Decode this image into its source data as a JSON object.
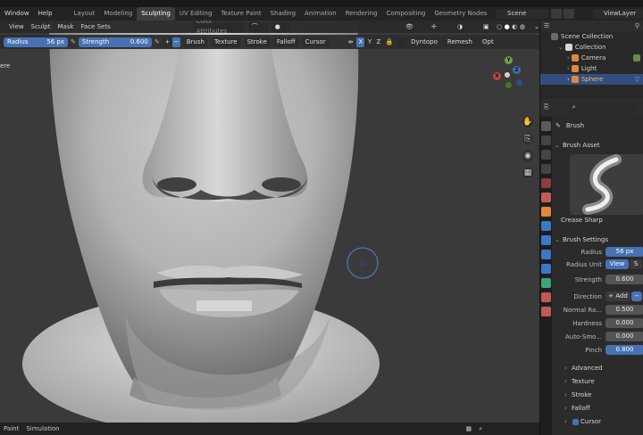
{
  "topbar": {
    "menus": [
      "Window",
      "Help"
    ],
    "workspace_tabs": [
      "Layout",
      "Modeling",
      "Sculpting",
      "UV Editing",
      "Texture Paint",
      "Shading",
      "Animation",
      "Rendering",
      "Compositing",
      "Geometry Nodes",
      "Sc"
    ],
    "active_tab": "Sculpting",
    "scene": "Scene",
    "view_layer": "ViewLayer"
  },
  "viewport": {
    "header": {
      "menus": [
        "View",
        "Sculpt",
        "Mask",
        "Face Sets"
      ],
      "color_attributes_label": "Color Attributes"
    },
    "toolbar": {
      "radius_label": "Radius",
      "radius_value": "56 px",
      "strength_label": "Strength",
      "strength_value": "0.600",
      "brush_label": "Brush",
      "texture_label": "Texture",
      "stroke_label": "Stroke",
      "falloff_label": "Falloff",
      "cursor_label": "Cursor",
      "axis_x": "X",
      "axis_y": "Y",
      "axis_z": "Z",
      "dyntopo_label": "Dyntopo",
      "remesh_label": "Remesh",
      "options_label": "Opt"
    },
    "left_edge_text": "ere",
    "gizmo": {
      "x": "X",
      "y": "Y",
      "z": "Z"
    },
    "footer": {
      "paint": "Paint",
      "simulation": "Simulation"
    }
  },
  "outliner": {
    "title": "Scene Collection",
    "items": [
      {
        "label": "Collection",
        "color": "#d8d8d8"
      },
      {
        "label": "Camera",
        "color": "#e0893a"
      },
      {
        "label": "Light",
        "color": "#e0893a"
      },
      {
        "label": "Sphere",
        "color": "#e0893a"
      }
    ]
  },
  "properties": {
    "brush_title": "Brush",
    "brush_asset_label": "Brush Asset",
    "brush_name": "Crease Sharp",
    "brush_settings_label": "Brush Settings",
    "rows": [
      {
        "label": "Radius",
        "value": "56 px"
      },
      {
        "label": "Radius Unit",
        "value": "View",
        "alt": "S"
      },
      {
        "label": "Strength",
        "value": "0.600"
      },
      {
        "label": "Direction",
        "value": "Add"
      },
      {
        "label": "Normal Ra...",
        "value": "0.500"
      },
      {
        "label": "Hardness",
        "value": "0.000"
      },
      {
        "label": "Auto-Smo...",
        "value": "0.000"
      },
      {
        "label": "Pinch",
        "value": "0.800"
      }
    ],
    "subpanels": [
      "Advanced",
      "Texture",
      "Stroke",
      "Falloff",
      "Cursor"
    ]
  },
  "colors": {
    "accent_blue": "#4772b3",
    "viewport_bg": "#3a3a3a",
    "selected_row": "#334d80"
  }
}
